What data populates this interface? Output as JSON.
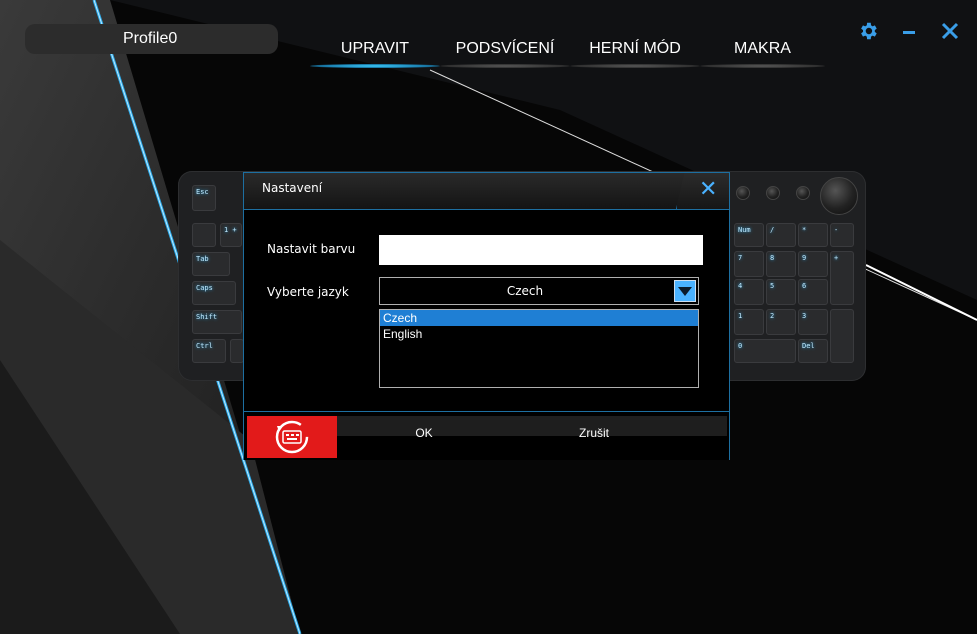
{
  "profile": {
    "name": "Profile0"
  },
  "nav": {
    "tabs": [
      {
        "label": "UPRAVIT",
        "active": true
      },
      {
        "label": "PODSVÍCENÍ",
        "active": false
      },
      {
        "label": "HERNÍ MÓD",
        "active": false
      },
      {
        "label": "MAKRA",
        "active": false
      }
    ]
  },
  "window": {
    "settings_icon": "gear-icon",
    "minimize_icon": "minimize-icon",
    "close_icon": "close-icon"
  },
  "keyboard_keys": {
    "esc": "Esc",
    "one": "1 +",
    "tab": "Tab",
    "caps": "Caps",
    "shift": "Shift",
    "ctrl": "Ctrl",
    "num": "Num",
    "slash": "/",
    "star": "*",
    "minus": "-",
    "n7": "7",
    "n8": "8",
    "n9": "9",
    "plus": "+",
    "n4": "4",
    "n5": "5",
    "n6": "6",
    "n1": "1",
    "n2": "2",
    "n3": "3",
    "n0": "0",
    "del": "Del"
  },
  "dialog": {
    "title": "Nastavení",
    "color_label": "Nastavit barvu",
    "color_value": "",
    "language_label": "Vyberte jazyk",
    "language_selected": "Czech",
    "language_options": [
      "Czech",
      "English"
    ],
    "ok_label": "OK",
    "cancel_label": "Zrušit"
  },
  "colors": {
    "accent": "#4ab2ff",
    "dialog_border": "#1d6fa1",
    "reset_button": "#e21a1a",
    "selection": "#1f7fd4"
  }
}
